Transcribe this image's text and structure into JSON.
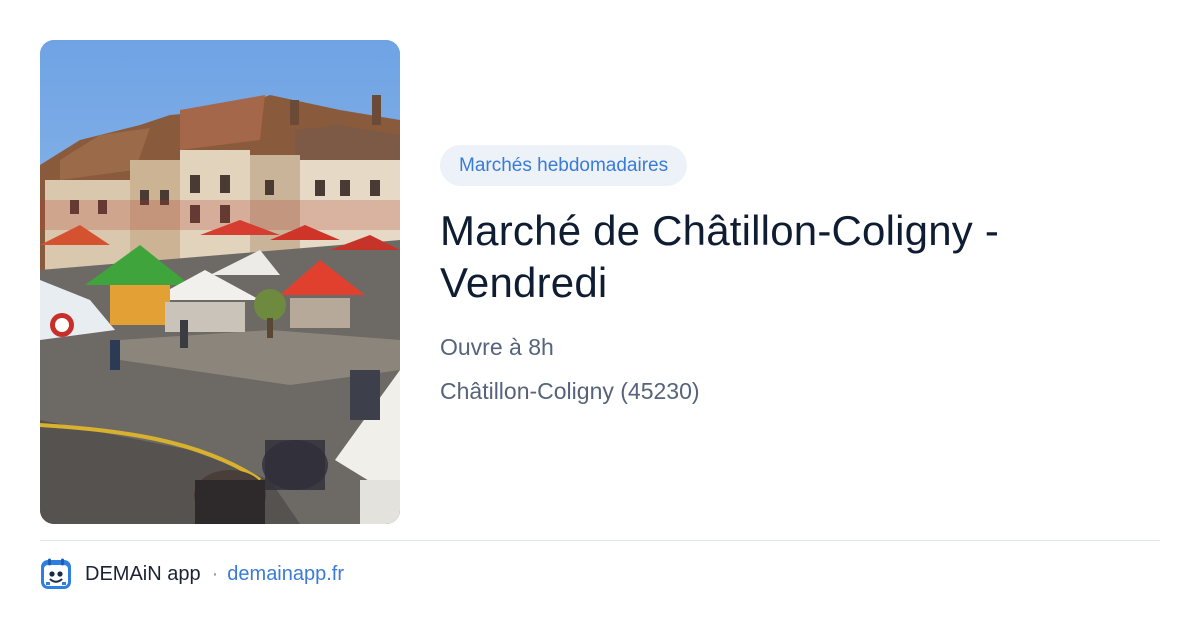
{
  "card": {
    "category": "Marchés hebdomadaires",
    "title": "Marché de Châtillon-Coligny - Vendredi",
    "opening": "Ouvre à 8h",
    "location": "Châtillon-Coligny (45230)"
  },
  "footer": {
    "app_name": "DEMAiN app",
    "separator": "·",
    "url": "demainapp.fr"
  },
  "colors": {
    "accent": "#3a7bd5",
    "title": "#0f1d33",
    "muted": "#56637a",
    "badge_bg": "#edf2f9"
  },
  "icons": {
    "logo": "calendar-face-icon"
  }
}
